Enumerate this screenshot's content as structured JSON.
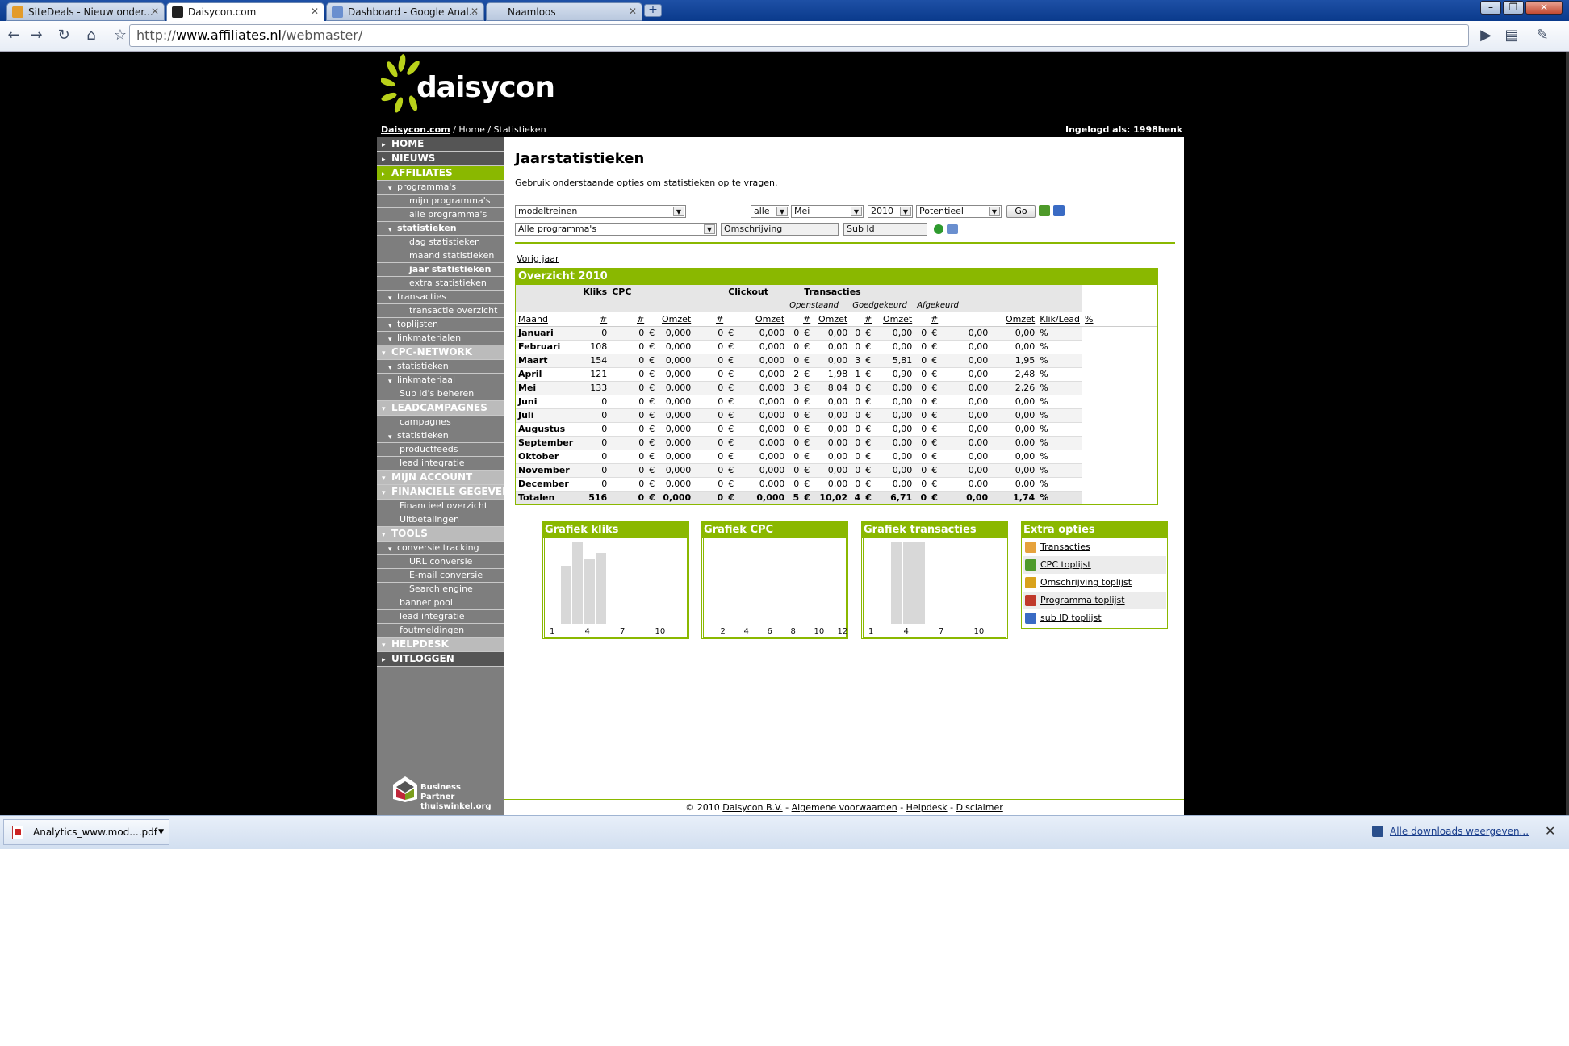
{
  "browser": {
    "tabs": [
      {
        "title": "SiteDeals - Nieuw onder..."
      },
      {
        "title": "Daisycon.com"
      },
      {
        "title": "Dashboard - Google Anal..."
      },
      {
        "title": "Naamloos"
      }
    ],
    "url_prefix": "http://",
    "url_domain": "www.affiliates.nl",
    "url_path": "/webmaster/",
    "icons": [
      "back-icon",
      "forward-icon",
      "reload-icon",
      "home-icon",
      "star-icon",
      "play-icon",
      "page-menu-icon",
      "wrench-icon"
    ]
  },
  "site": {
    "logo_text": "daisycon",
    "crumb_home_link": "Daisycon.com",
    "crumb_path": " /  Home / Statistieken",
    "logged_in": "Ingelogd als: 1998henk"
  },
  "sidebar": [
    {
      "label": "HOME",
      "level": 0
    },
    {
      "label": "NIEUWS",
      "level": 0
    },
    {
      "label": "AFFILIATES",
      "level": 0,
      "active": true
    },
    {
      "label": "programma's",
      "level": 1
    },
    {
      "label": "mijn programma's",
      "level": 2
    },
    {
      "label": "alle programma's",
      "level": 2
    },
    {
      "label": "statistieken",
      "level": 1,
      "bold": true
    },
    {
      "label": "dag statistieken",
      "level": 2
    },
    {
      "label": "maand statistieken",
      "level": 2
    },
    {
      "label": "jaar statistieken",
      "level": 2,
      "current": true
    },
    {
      "label": "extra statistieken",
      "level": 2
    },
    {
      "label": "transacties",
      "level": 1
    },
    {
      "label": "transactie overzicht",
      "level": 2
    },
    {
      "label": "toplijsten",
      "level": 1
    },
    {
      "label": "linkmaterialen",
      "level": 1
    },
    {
      "label": "CPC-NETWORK",
      "level": 0,
      "grey": true
    },
    {
      "label": "statistieken",
      "level": 1
    },
    {
      "label": "linkmateriaal",
      "level": 1
    },
    {
      "label": "Sub id's beheren",
      "level": "1b"
    },
    {
      "label": "LEADCAMPAGNES",
      "level": 0,
      "grey": true
    },
    {
      "label": "campagnes",
      "level": "1b"
    },
    {
      "label": "statistieken",
      "level": 1
    },
    {
      "label": "productfeeds",
      "level": "1b"
    },
    {
      "label": "lead integratie",
      "level": "1b"
    },
    {
      "label": "MIJN ACCOUNT",
      "level": 0,
      "grey": true
    },
    {
      "label": "FINANCIELE GEGEVENS",
      "level": 0,
      "grey": true
    },
    {
      "label": "Financieel overzicht",
      "level": "1b"
    },
    {
      "label": "Uitbetalingen",
      "level": "1b"
    },
    {
      "label": "TOOLS",
      "level": 0,
      "grey": true
    },
    {
      "label": "conversie tracking",
      "level": 1
    },
    {
      "label": "URL conversie",
      "level": 2
    },
    {
      "label": "E-mail conversie",
      "level": 2
    },
    {
      "label": "Search engine",
      "level": 2
    },
    {
      "label": "banner pool",
      "level": "1b"
    },
    {
      "label": "lead integratie",
      "level": "1b"
    },
    {
      "label": "foutmeldingen",
      "level": "1b"
    },
    {
      "label": "HELPDESK",
      "level": 0,
      "grey": true
    },
    {
      "label": "UITLOGGEN",
      "level": 0
    }
  ],
  "business_partner": {
    "line1": "Business Partner",
    "line2": "thuiswinkel.org"
  },
  "main": {
    "title": "Jaarstatistieken",
    "intro": "Gebruik onderstaande opties om statistieken op te vragen.",
    "filters": {
      "program": "modeltreinen",
      "scope": "alle",
      "month": "Mei",
      "year": "2010",
      "type": "Potentieel",
      "go": "Go",
      "all_programs": "Alle programma's",
      "description_placeholder": "Omschrijving",
      "subid_placeholder": "Sub Id"
    },
    "prev_year": "Vorig jaar",
    "overview": {
      "title": "Overzicht 2010",
      "group_headers": {
        "kliks": "Kliks",
        "cpc": "CPC",
        "clickout": "Clickout",
        "transacties": "Transacties"
      },
      "sub_headers": {
        "openstaand": "Openstaand",
        "goedgekeurd": "Goedgekeurd",
        "afgekeurd": "Afgekeurd"
      },
      "columns": [
        "Maand",
        "#",
        "#",
        "Omzet",
        "#",
        "Omzet",
        "#",
        "Omzet",
        "#",
        "Omzet",
        "#",
        "Omzet",
        "Klik/Lead",
        "%"
      ],
      "rows": [
        {
          "maand": "Januari",
          "kliks": "0",
          "cpc": "0",
          "cpc_omzet": "0,000",
          "co": "0",
          "co_omzet": "0,000",
          "op": "0",
          "op_omzet": "0,00",
          "gk": "0",
          "gk_omzet": "0,00",
          "ak": "0",
          "ak_omzet": "0,00",
          "kl": "0,00"
        },
        {
          "maand": "Februari",
          "kliks": "108",
          "cpc": "0",
          "cpc_omzet": "0,000",
          "co": "0",
          "co_omzet": "0,000",
          "op": "0",
          "op_omzet": "0,00",
          "gk": "0",
          "gk_omzet": "0,00",
          "ak": "0",
          "ak_omzet": "0,00",
          "kl": "0,00"
        },
        {
          "maand": "Maart",
          "kliks": "154",
          "cpc": "0",
          "cpc_omzet": "0,000",
          "co": "0",
          "co_omzet": "0,000",
          "op": "0",
          "op_omzet": "0,00",
          "gk": "3",
          "gk_omzet": "5,81",
          "ak": "0",
          "ak_omzet": "0,00",
          "kl": "1,95"
        },
        {
          "maand": "April",
          "kliks": "121",
          "cpc": "0",
          "cpc_omzet": "0,000",
          "co": "0",
          "co_omzet": "0,000",
          "op": "2",
          "op_omzet": "1,98",
          "gk": "1",
          "gk_omzet": "0,90",
          "ak": "0",
          "ak_omzet": "0,00",
          "kl": "2,48"
        },
        {
          "maand": "Mei",
          "kliks": "133",
          "cpc": "0",
          "cpc_omzet": "0,000",
          "co": "0",
          "co_omzet": "0,000",
          "op": "3",
          "op_omzet": "8,04",
          "gk": "0",
          "gk_omzet": "0,00",
          "ak": "0",
          "ak_omzet": "0,00",
          "kl": "2,26"
        },
        {
          "maand": "Juni",
          "kliks": "0",
          "cpc": "0",
          "cpc_omzet": "0,000",
          "co": "0",
          "co_omzet": "0,000",
          "op": "0",
          "op_omzet": "0,00",
          "gk": "0",
          "gk_omzet": "0,00",
          "ak": "0",
          "ak_omzet": "0,00",
          "kl": "0,00"
        },
        {
          "maand": "Juli",
          "kliks": "0",
          "cpc": "0",
          "cpc_omzet": "0,000",
          "co": "0",
          "co_omzet": "0,000",
          "op": "0",
          "op_omzet": "0,00",
          "gk": "0",
          "gk_omzet": "0,00",
          "ak": "0",
          "ak_omzet": "0,00",
          "kl": "0,00"
        },
        {
          "maand": "Augustus",
          "kliks": "0",
          "cpc": "0",
          "cpc_omzet": "0,000",
          "co": "0",
          "co_omzet": "0,000",
          "op": "0",
          "op_omzet": "0,00",
          "gk": "0",
          "gk_omzet": "0,00",
          "ak": "0",
          "ak_omzet": "0,00",
          "kl": "0,00"
        },
        {
          "maand": "September",
          "kliks": "0",
          "cpc": "0",
          "cpc_omzet": "0,000",
          "co": "0",
          "co_omzet": "0,000",
          "op": "0",
          "op_omzet": "0,00",
          "gk": "0",
          "gk_omzet": "0,00",
          "ak": "0",
          "ak_omzet": "0,00",
          "kl": "0,00"
        },
        {
          "maand": "Oktober",
          "kliks": "0",
          "cpc": "0",
          "cpc_omzet": "0,000",
          "co": "0",
          "co_omzet": "0,000",
          "op": "0",
          "op_omzet": "0,00",
          "gk": "0",
          "gk_omzet": "0,00",
          "ak": "0",
          "ak_omzet": "0,00",
          "kl": "0,00"
        },
        {
          "maand": "November",
          "kliks": "0",
          "cpc": "0",
          "cpc_omzet": "0,000",
          "co": "0",
          "co_omzet": "0,000",
          "op": "0",
          "op_omzet": "0,00",
          "gk": "0",
          "gk_omzet": "0,00",
          "ak": "0",
          "ak_omzet": "0,00",
          "kl": "0,00"
        },
        {
          "maand": "December",
          "kliks": "0",
          "cpc": "0",
          "cpc_omzet": "0,000",
          "co": "0",
          "co_omzet": "0,000",
          "op": "0",
          "op_omzet": "0,00",
          "gk": "0",
          "gk_omzet": "0,00",
          "ak": "0",
          "ak_omzet": "0,00",
          "kl": "0,00"
        }
      ],
      "totals": {
        "maand": "Totalen",
        "kliks": "516",
        "cpc": "0",
        "cpc_omzet": "0,000",
        "co": "0",
        "co_omzet": "0,000",
        "op": "5",
        "op_omzet": "10,02",
        "gk": "4",
        "gk_omzet": "6,71",
        "ak": "0",
        "ak_omzet": "0,00",
        "kl": "1,74"
      },
      "currency": "€",
      "percent": "%"
    },
    "panels": {
      "kliks": {
        "title": "Grafiek kliks",
        "ticks": [
          "1",
          "4",
          "7",
          "10"
        ]
      },
      "cpc": {
        "title": "Grafiek CPC",
        "ticks": [
          "2",
          "4",
          "6",
          "8",
          "10",
          "12"
        ]
      },
      "transacties": {
        "title": "Grafiek transacties",
        "ticks": [
          "1",
          "4",
          "7",
          "10"
        ]
      },
      "extra": {
        "title": "Extra opties",
        "items": [
          "Transacties",
          "CPC toplijst",
          "Omschrijving toplijst",
          "Programma toplijst",
          "sub ID toplijst"
        ]
      }
    },
    "chart_data": [
      {
        "type": "bar",
        "title": "Grafiek kliks",
        "x": [
          1,
          2,
          3,
          4,
          5,
          6,
          7,
          8,
          9,
          10,
          11,
          12
        ],
        "values": [
          0,
          108,
          154,
          121,
          133,
          0,
          0,
          0,
          0,
          0,
          0,
          0
        ]
      },
      {
        "type": "bar",
        "title": "Grafiek CPC",
        "x": [
          1,
          2,
          3,
          4,
          5,
          6,
          7,
          8,
          9,
          10,
          11,
          12
        ],
        "values": [
          0,
          0,
          0,
          0,
          0,
          0,
          0,
          0,
          0,
          0,
          0,
          0
        ]
      },
      {
        "type": "bar",
        "title": "Grafiek transacties",
        "x": [
          1,
          2,
          3,
          4,
          5,
          6,
          7,
          8,
          9,
          10,
          11,
          12
        ],
        "values": [
          0,
          0,
          3,
          3,
          3,
          0,
          0,
          0,
          0,
          0,
          0,
          0
        ]
      }
    ],
    "footer": {
      "copyright": "© 2010",
      "company": "Daisycon B.V.",
      "links": [
        "Algemene voorwaarden",
        "Helpdesk",
        "Disclaimer"
      ],
      "sep": " - "
    }
  },
  "downloads": {
    "file": "Analytics_www.mod....pdf",
    "show_all": "Alle downloads weergeven...",
    "close": "✕"
  }
}
